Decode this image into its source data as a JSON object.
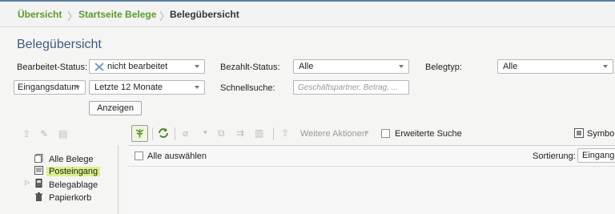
{
  "breadcrumb": {
    "items": [
      "Übersicht",
      "Startseite Belege",
      "Belegübersicht"
    ]
  },
  "page": {
    "title": "Belegübersicht"
  },
  "filters": {
    "bearbeitet_status_label": "Bearbeitet-Status:",
    "bearbeitet_status_value": "nicht bearbeitet",
    "bezahlt_status_label": "Bezahlt-Status:",
    "bezahlt_status_value": "Alle",
    "belegtyp_label": "Belegtyp:",
    "belegtyp_value": "Alle",
    "date_field_value": "Eingangsdatum",
    "date_range_value": "Letzte 12 Monate",
    "schnellsuche_label": "Schnellsuche:",
    "schnellsuche_placeholder": "Geschäftspartner, Betrag, ...",
    "anzeigen_label": "Anzeigen"
  },
  "toolbar": {
    "weitere_aktionen_label": "Weitere Aktionen",
    "erweiterte_suche_label": "Erweiterte Suche",
    "symbolansicht_label": "Symbola"
  },
  "tree": {
    "items": [
      {
        "label": "Alle Belege",
        "icon": "documents-icon",
        "selected": false
      },
      {
        "label": "Posteingang",
        "icon": "inbox-icon",
        "selected": true
      },
      {
        "label": "Belegablage",
        "icon": "binder-icon",
        "selected": false,
        "expandable": true
      },
      {
        "label": "Papierkorb",
        "icon": "trash-icon",
        "selected": false
      }
    ]
  },
  "list": {
    "select_all_label": "Alle auswählen",
    "sort_label": "Sortierung:",
    "sort_value": "Eingangsd"
  },
  "colors": {
    "accent_green": "#5a9a2c",
    "title_blue": "#3d5a80",
    "selected_bg": "#d9f08a"
  }
}
